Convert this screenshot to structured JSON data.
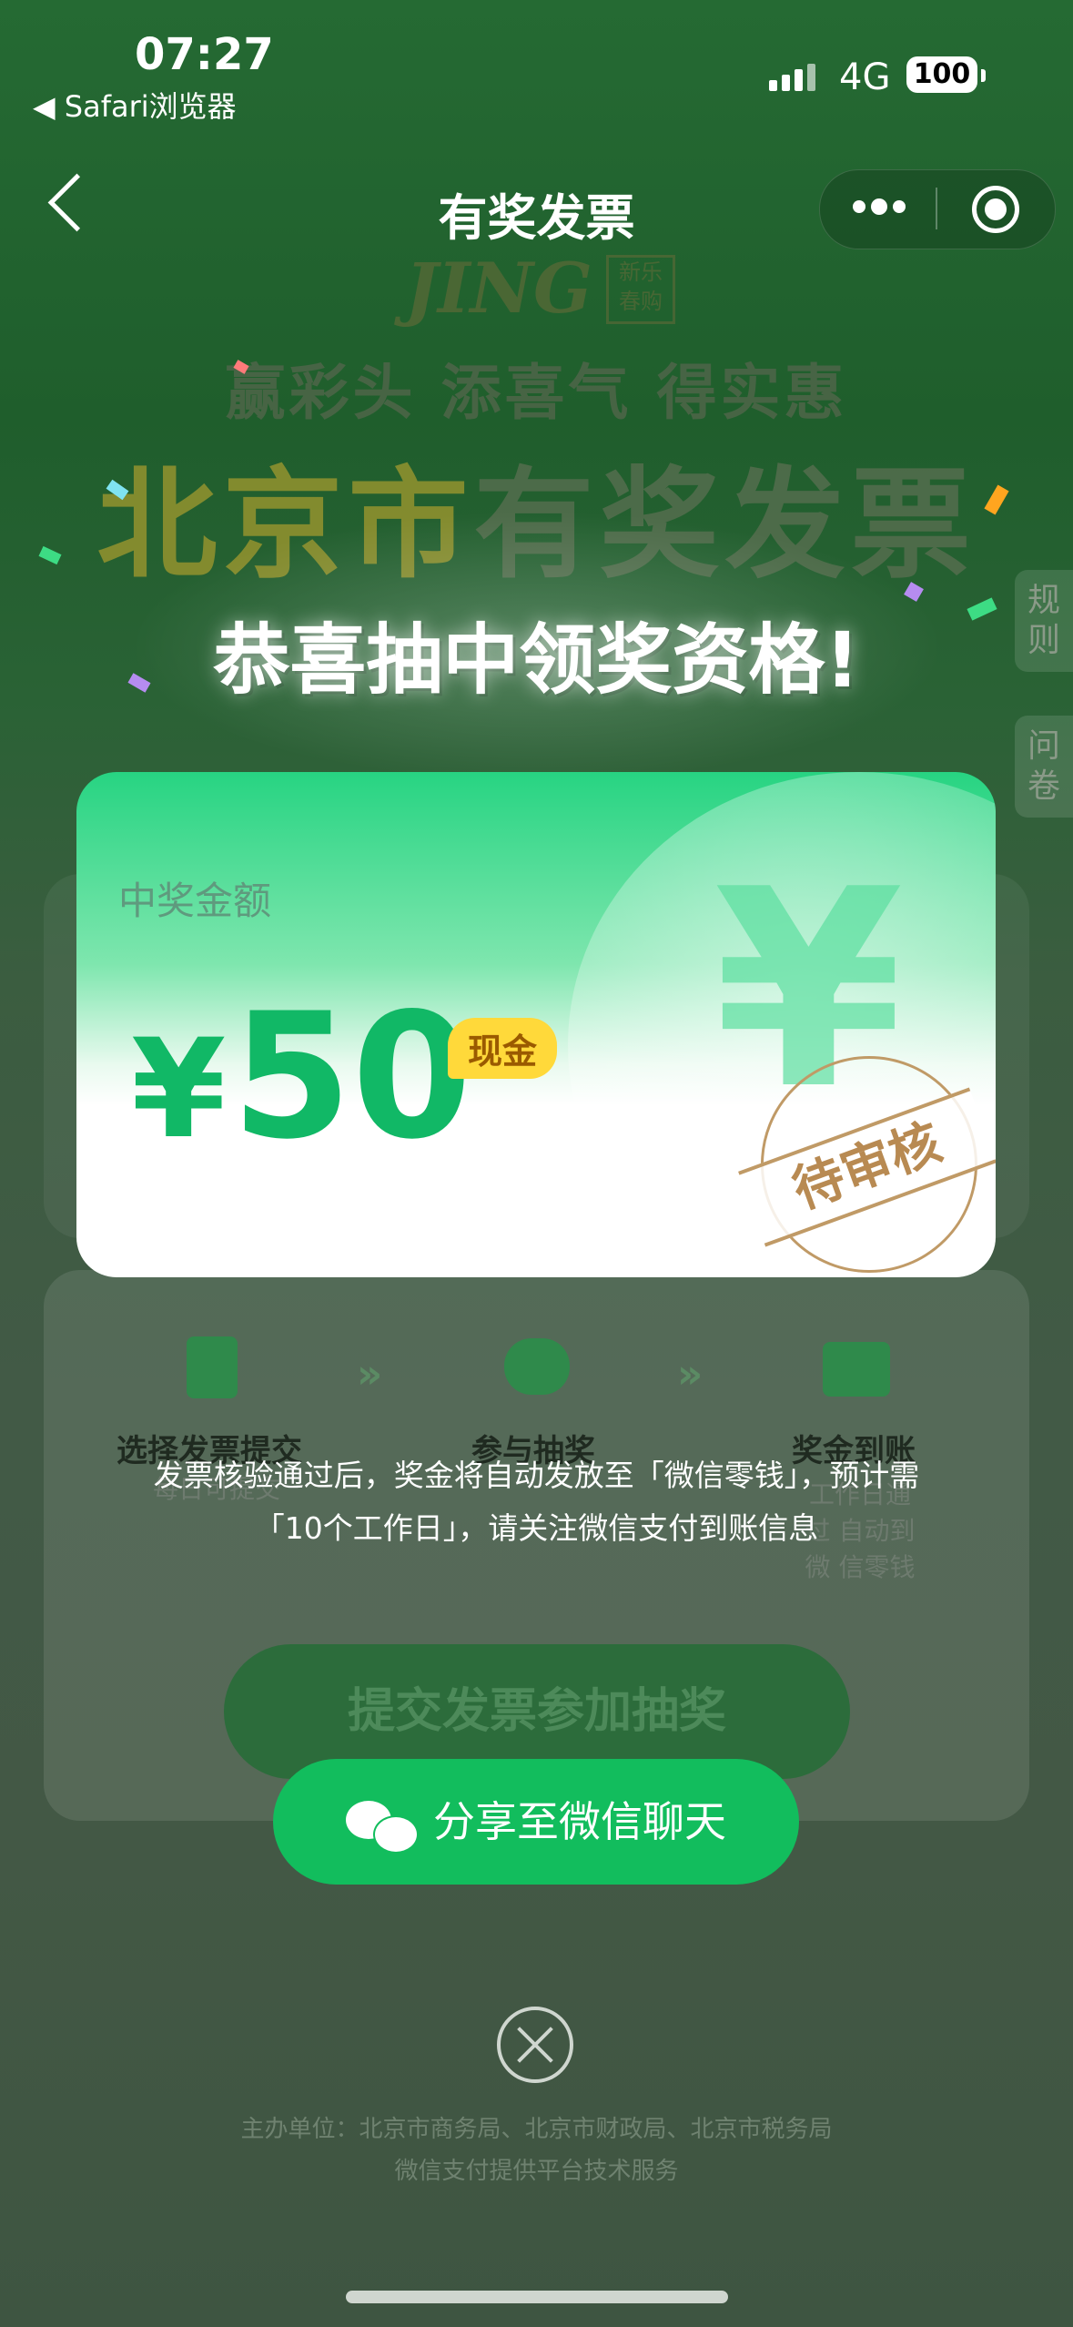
{
  "status_bar": {
    "time": "07:27",
    "back_app": "◀ Safari浏览器",
    "network": "4G",
    "battery": "100"
  },
  "nav": {
    "title": "有奖发票"
  },
  "background": {
    "logo_text": "JING",
    "logo_seal": "新乐春购",
    "slogan": "赢彩头 添喜气 得实惠",
    "banner_part1": "北京市",
    "banner_part2": "有奖发票",
    "side_tab_rules": "规则",
    "side_tab_survey": "问卷"
  },
  "headline": "恭喜抽中领奖资格!",
  "prize_card": {
    "label": "中奖金额",
    "currency_symbol": "¥",
    "amount": "50",
    "badge": "现金",
    "stamp": "待审核",
    "watermark": "¥"
  },
  "process": {
    "steps": [
      {
        "title": "选择发票提交",
        "sub": "每日可提交"
      },
      {
        "title": "参与抽奖",
        "sub": ""
      },
      {
        "title": "奖金到账",
        "sub": "工作日通过 自动到微 信零钱"
      }
    ],
    "submit_button": "提交发票参加抽奖"
  },
  "notice": {
    "line1": "发票核验通过后，奖金将自动发放至「微信零钱」，预计需",
    "line2": "「10个工作日」，请关注微信支付到账信息"
  },
  "share_button": "分享至微信聊天",
  "footer": {
    "line1": "主办单位：北京市商务局、北京市财政局、北京市税务局",
    "line2": "微信支付提供平台技术服务"
  },
  "colors": {
    "accent_green": "#12bd5d",
    "amount_green": "#11b866",
    "badge_yellow": "#ffd93a",
    "stamp_brown": "#c09a66"
  }
}
